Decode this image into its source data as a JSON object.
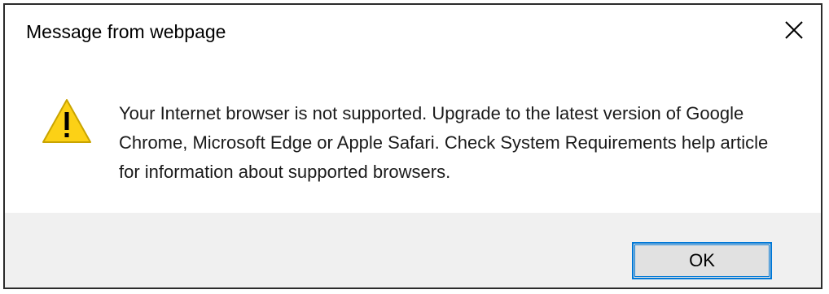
{
  "dialog": {
    "title": "Message from webpage",
    "close_icon": "close-icon",
    "warning_icon": "warning-icon",
    "message": "Your Internet browser is not supported. Upgrade to the latest version of Google Chrome, Microsoft Edge or Apple Safari. Check System Requirements help article for information about supported browsers.",
    "ok_label": "OK"
  },
  "colors": {
    "warning_fill": "#fcd116",
    "warning_stroke": "#c9a400",
    "button_focus_border": "#0078d7",
    "footer_background": "#f0f0f0"
  }
}
